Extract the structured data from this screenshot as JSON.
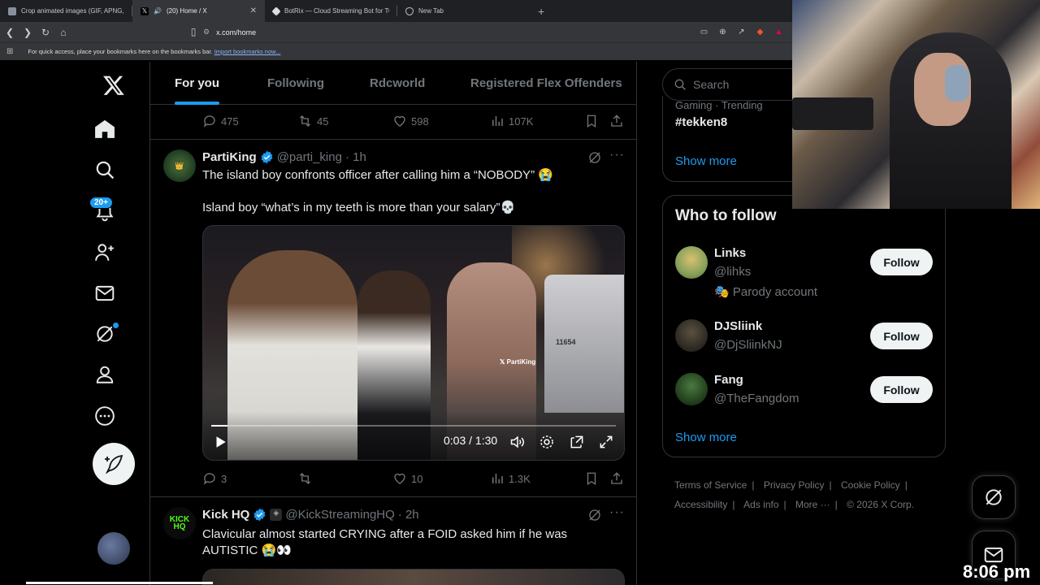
{
  "browser": {
    "tabs": [
      {
        "label": "Crop animated images (GIF, APNG, W",
        "active": false
      },
      {
        "label": "(20) Home / X",
        "active": true
      },
      {
        "label": "BotRix — Cloud Streaming Bot for Tw",
        "active": false
      },
      {
        "label": "New Tab",
        "active": false
      }
    ],
    "url": "x.com/home",
    "bookmarks_text": "For quick access, place your bookmarks here on the bookmarks bar.",
    "bookmarks_link": "Import bookmarks now..."
  },
  "nav": {
    "notification_count": "20+"
  },
  "feed_tabs": [
    "For you",
    "Following",
    "Rdcworld",
    "Registered Flex Offenders"
  ],
  "prev_tweet_actions": {
    "replies": "475",
    "reposts": "45",
    "likes": "598",
    "views": "107K"
  },
  "tweet1": {
    "name": "PartiKing",
    "handle": "@parti_king",
    "time": "· 1h",
    "text1": "The island boy confronts officer after calling him a “NOBODY” 😭",
    "text2": "Island boy “what’s in my teeth is more than your salary”💀",
    "video": {
      "time": "0:03 / 1:30",
      "watermark": "PartiKing",
      "progress": 0.04,
      "car_number": "11654"
    },
    "actions": {
      "replies": "3",
      "reposts": "",
      "likes": "10",
      "views": "1.3K"
    }
  },
  "tweet2": {
    "name": "Kick HQ",
    "handle": "@KickStreamingHQ",
    "time": "· 2h",
    "text": "Clavicular almost started CRYING after a FOID asked him if he was AUTISTIC 😭👀"
  },
  "search": {
    "placeholder": "Search"
  },
  "trending": {
    "meta": "Gaming · Trending",
    "tag": "#tekken8",
    "show_more": "Show more"
  },
  "who_to_follow": {
    "title": "Who to follow",
    "follow_label": "Follow",
    "users": [
      {
        "name": "Links",
        "handle": "@lihks",
        "note": "🎭 Parody account"
      },
      {
        "name": "DJSliink",
        "handle": "@DjSliinkNJ"
      },
      {
        "name": "Fang",
        "handle": "@TheFangdom"
      }
    ],
    "show_more": "Show more"
  },
  "footer": {
    "links": [
      "Terms of Service",
      "Privacy Policy",
      "Cookie Policy",
      "Accessibility",
      "Ads info",
      "More ···"
    ],
    "copyright": "© 2026 X Corp."
  },
  "clock": "8:06 pm",
  "colors": {
    "accent": "#1d9bf0",
    "text": "#e7e9ea",
    "muted": "#71767b",
    "border": "#2f3336"
  }
}
